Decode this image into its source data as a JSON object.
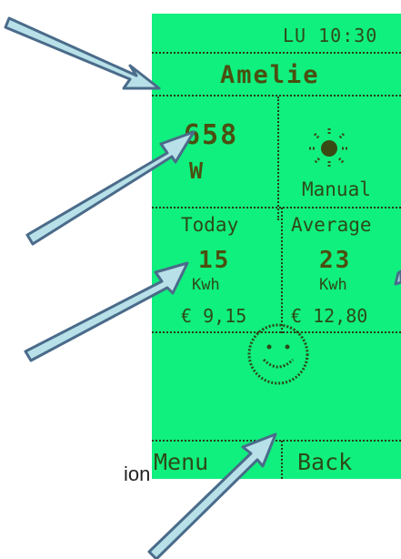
{
  "status_bar": {
    "clock": "LU 10:30"
  },
  "user": {
    "name": "Amelie"
  },
  "power": {
    "value": "658",
    "unit": "W"
  },
  "mode": {
    "icon": "sun-icon",
    "label": "Manual"
  },
  "today": {
    "label": "Today",
    "value": "15",
    "unit": "Kwh",
    "cost": "€ 9,15"
  },
  "average": {
    "label": "Average",
    "value": "23",
    "unit": "Kwh",
    "cost": "€ 12,80"
  },
  "feedback": {
    "icon": "smiley-icon"
  },
  "softkeys": {
    "menu": "Menu",
    "back": "Back"
  },
  "caption": {
    "text": "ion"
  },
  "colors": {
    "lcd_background": "#10f07e",
    "lcd_text": "#2d4a16",
    "arrow": "#b8e0e8",
    "arrow_outline": "#4a6b8a"
  }
}
